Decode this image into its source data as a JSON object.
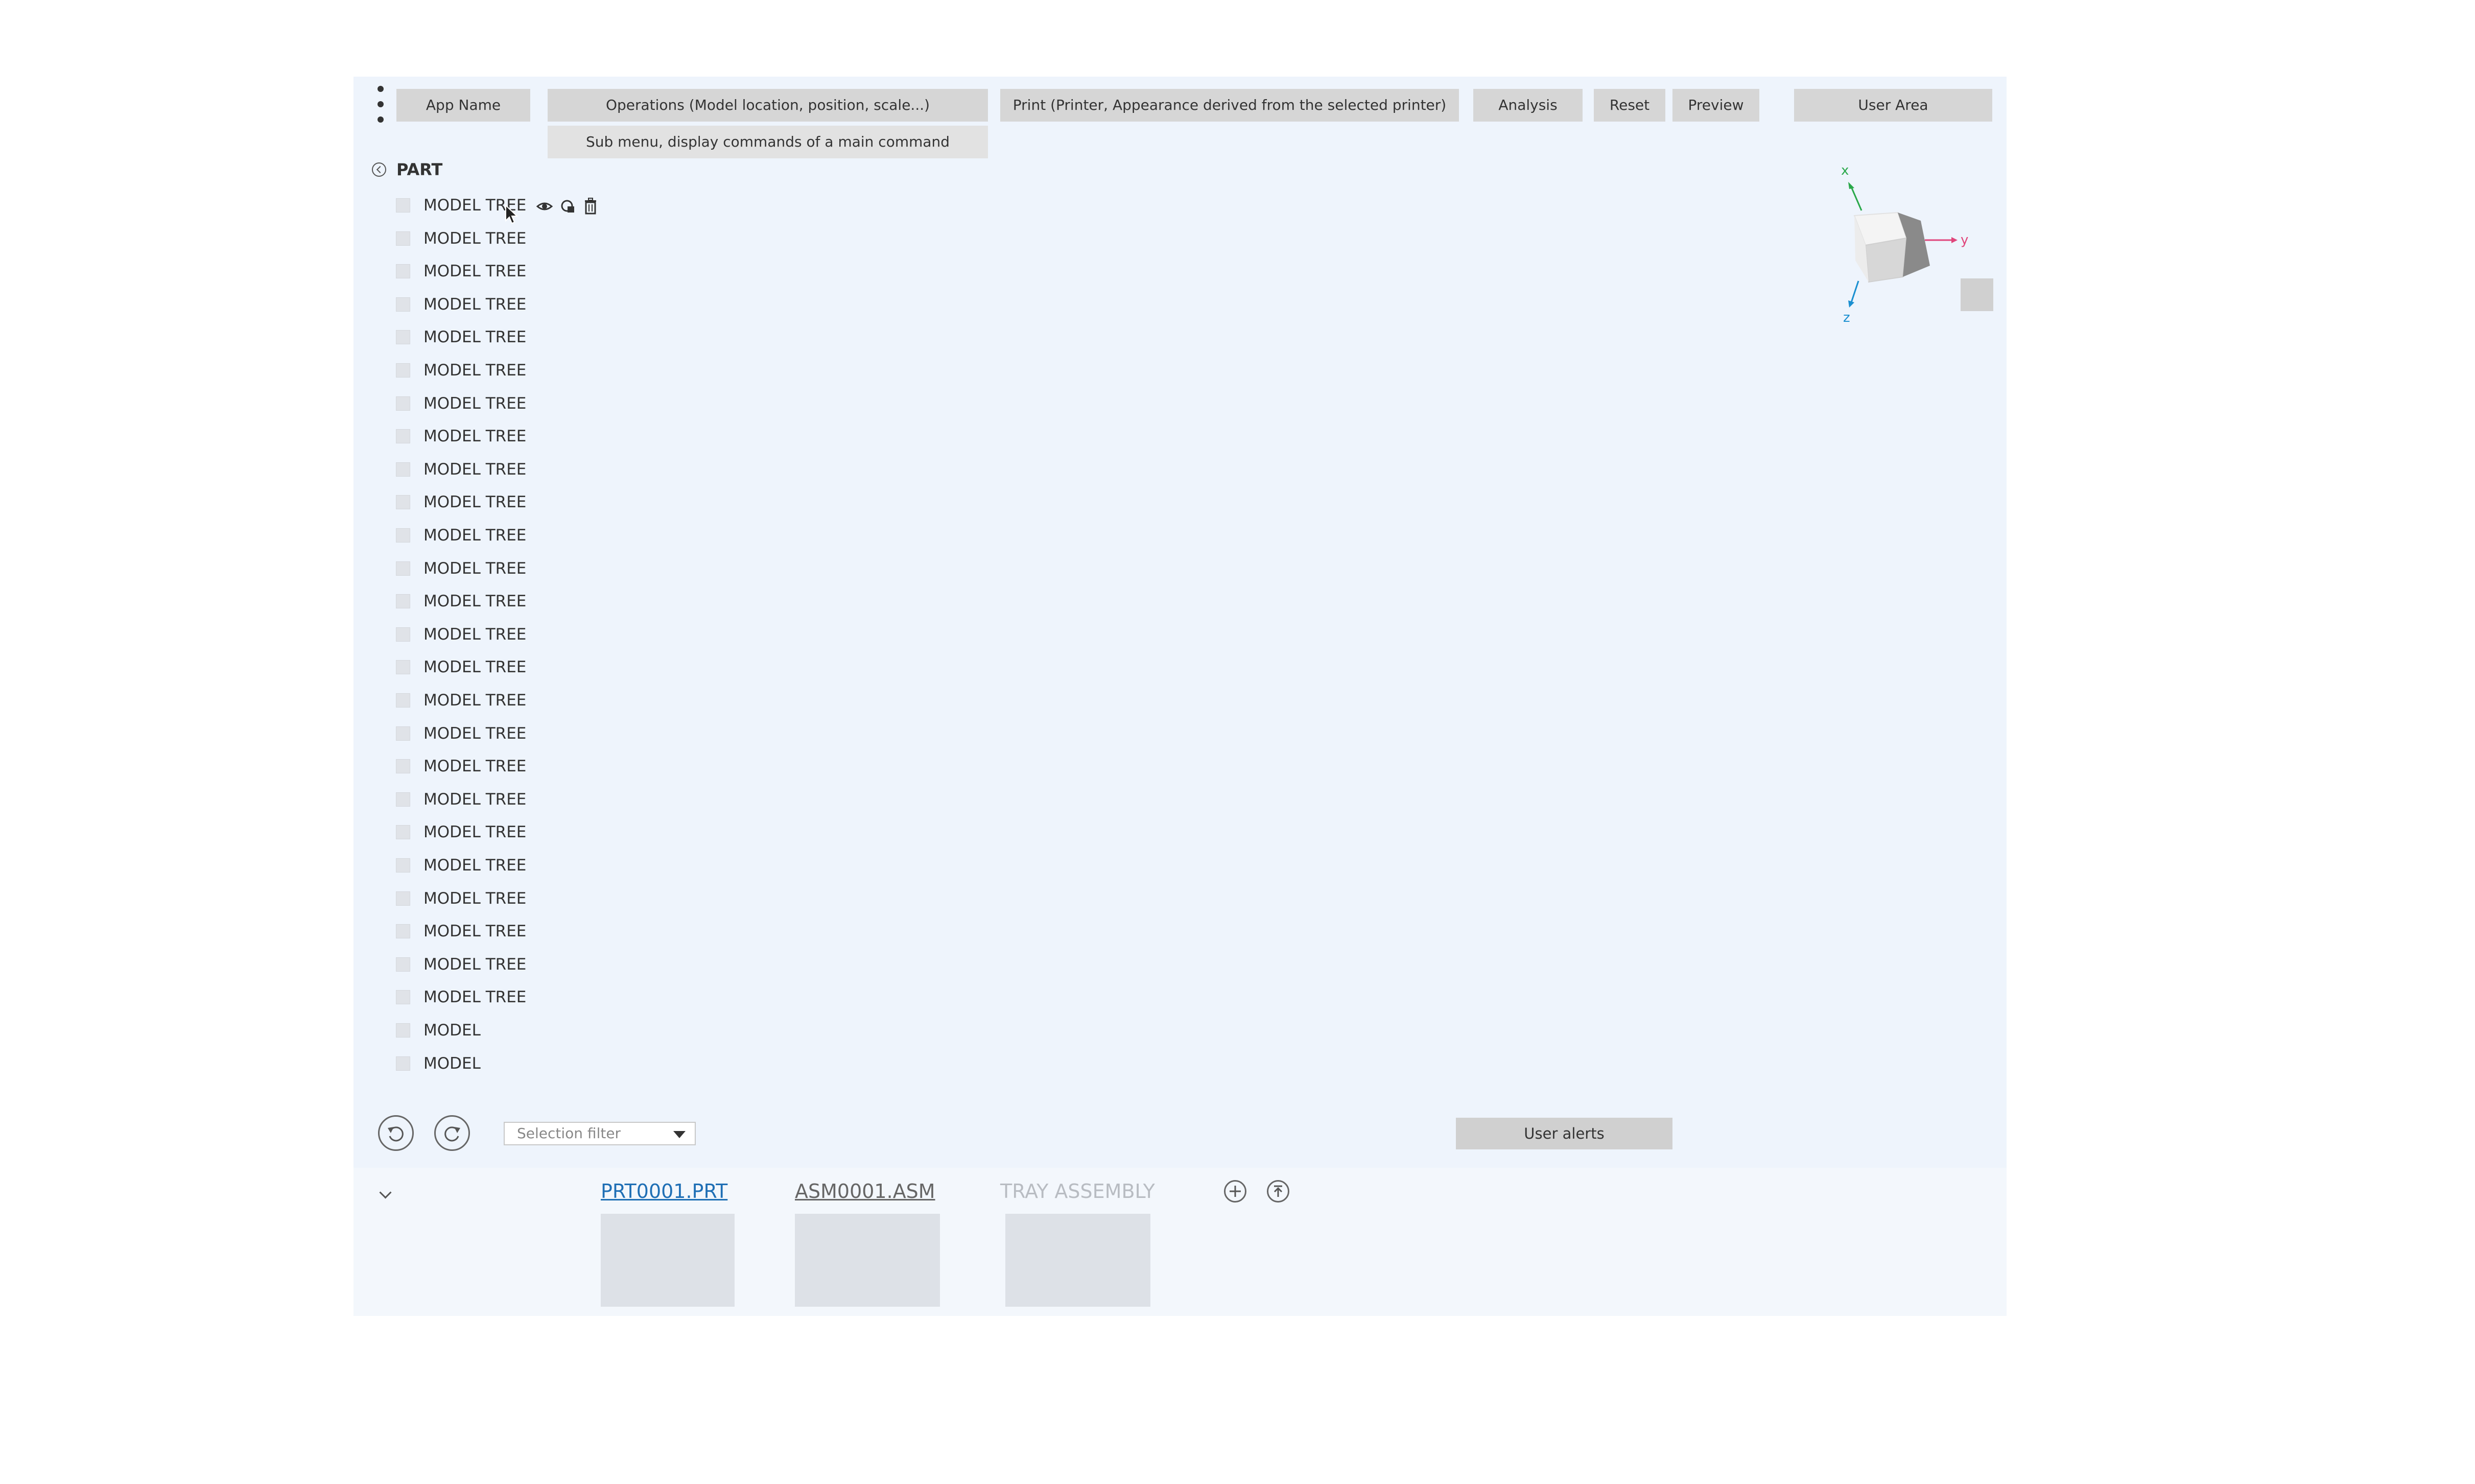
{
  "topbar": {
    "app_name": "App Name",
    "operations": "Operations (Model location, position, scale...)",
    "print": "Print (Printer, Appearance derived from the selected printer)",
    "analysis": "Analysis",
    "reset": "Reset",
    "preview": "Preview",
    "user_area": "User Area",
    "submenu": "Sub menu, display commands of a main command"
  },
  "part": {
    "title": "PART"
  },
  "tree": {
    "items": [
      "MODEL TREE",
      "MODEL TREE",
      "MODEL TREE",
      "MODEL TREE",
      "MODEL TREE",
      "MODEL TREE",
      "MODEL TREE",
      "MODEL TREE",
      "MODEL TREE",
      "MODEL TREE",
      "MODEL TREE",
      "MODEL TREE",
      "MODEL TREE",
      "MODEL TREE",
      "MODEL TREE",
      "MODEL TREE",
      "MODEL TREE",
      "MODEL TREE",
      "MODEL TREE",
      "MODEL TREE",
      "MODEL TREE",
      "MODEL TREE",
      "MODEL TREE",
      "MODEL TREE",
      "MODEL TREE",
      "MODEL",
      "MODEL"
    ],
    "row_icons": [
      "eye-icon",
      "layers-icon",
      "trash-icon"
    ]
  },
  "viewcube": {
    "x_label": "x",
    "y_label": "y",
    "z_label": "z",
    "x_color": "#2aa84a",
    "y_color": "#e0457b",
    "z_color": "#1a8fd0"
  },
  "toolbar": {
    "undo_icon": "undo-icon",
    "redo_icon": "redo-icon",
    "selection_filter_placeholder": "Selection filter",
    "user_alerts": "User alerts"
  },
  "files": {
    "tabs": [
      {
        "label": "PRT0001.PRT",
        "color": "#1f6fb5",
        "active": true
      },
      {
        "label": "ASM0001.ASM",
        "color": "#666666",
        "active": false
      },
      {
        "label": "TRAY ASSEMBLY",
        "color": "#b8bcc2",
        "active": false
      }
    ],
    "actions": [
      "add-icon",
      "upload-icon"
    ]
  }
}
